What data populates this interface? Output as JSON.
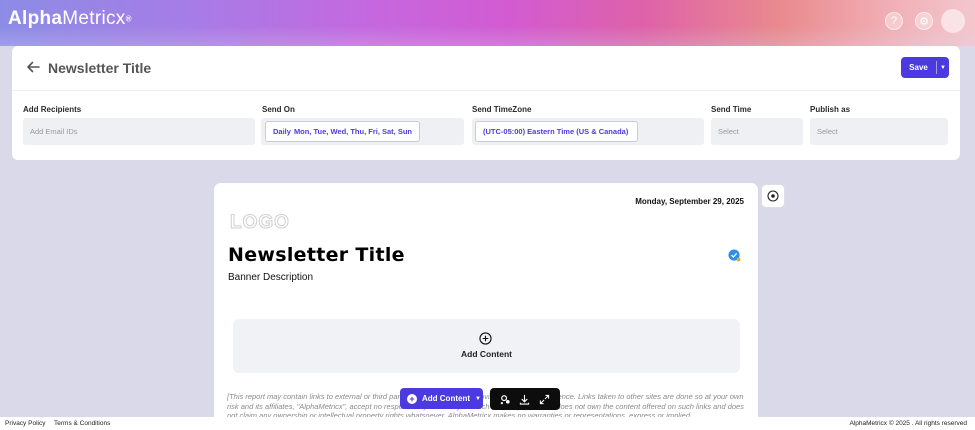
{
  "brand": {
    "name_bold": "Alpha",
    "name_light": "Metricx",
    "mark": "®"
  },
  "topbar": {
    "help_icon": "question-circle-icon",
    "settings_icon": "gear-icon",
    "help_glyph": "?",
    "settings_glyph": "⚙"
  },
  "header": {
    "title": "Newsletter Title",
    "save_label": "Save",
    "save_caret": "▼"
  },
  "fields": {
    "recipients": {
      "label": "Add Recipients",
      "placeholder": "Add Email IDs"
    },
    "send_on": {
      "label": "Send On",
      "frequency": "Daily",
      "days": "Mon, Tue, Wed, Thu, Fri, Sat, Sun"
    },
    "timezone": {
      "label": "Send TimeZone",
      "value": "(UTC-05:00) Eastern Time (US & Canada)"
    },
    "send_time": {
      "label": "Send Time",
      "placeholder": "Select"
    },
    "publish_as": {
      "label": "Publish as",
      "placeholder": "Select"
    }
  },
  "newsletter": {
    "date": "Monday, September 29, 2025",
    "logo_placeholder": "LOGO",
    "title": "Newsletter Title",
    "banner_description": "Banner Description",
    "add_content_label": "Add Content",
    "disclaimer": "[This report may contain links to external or third party websites which are provided for your convenience. Links taken to other sites are done so at your own risk and its affiliates, \"AlphaMetricx\", accept no responsibility or liability for such sites. AlphaMetricx does not own the content offered on such links and does not claim any ownership or intellectual property rights whatsoever. AlphaMetricx makes no warranties or representations, express or implied."
  },
  "toolbar": {
    "add_content_label": "Add Content",
    "add_caret": "▼",
    "icons": [
      "settings-sync-icon",
      "download-icon",
      "expand-icon"
    ]
  },
  "footer": {
    "privacy": "Privacy Policy",
    "terms": "Terms & Conditions",
    "copyright": "AlphaMetricx © 2025 . All rights reserved"
  },
  "colors": {
    "accent": "#4b3ae0",
    "page_bg": "#d9d9ea",
    "toolbar_dark": "#0d0d0d"
  }
}
